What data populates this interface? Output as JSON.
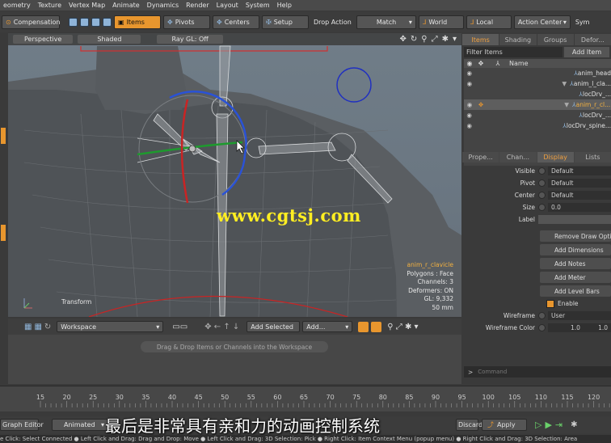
{
  "menu": [
    "eometry",
    "Texture",
    "Vertex Map",
    "Animate",
    "Dynamics",
    "Render",
    "Layout",
    "System",
    "Help"
  ],
  "toolbar": {
    "compensation": "Compensation",
    "items": "Items",
    "pivots": "Pivots",
    "centers": "Centers",
    "setup": "Setup",
    "drop_action_label": "Drop Action",
    "drop_action_value": "Match",
    "world": "World",
    "local": "Local",
    "action_center": "Action Center",
    "sym": "Sym"
  },
  "viewport": {
    "view_mode": "Perspective",
    "shading": "Shaded",
    "render_mode": "Ray GL: Off",
    "transform_label": "Transform",
    "watermark": "www.cgtsj.com",
    "info": {
      "selected": "anim_r_clavicle",
      "polygons": "Polygons : Face",
      "channels": "Channels: 3",
      "deformers": "Deformers: ON",
      "gl": "GL: 9,332",
      "units": "50 mm"
    }
  },
  "workspace": {
    "name": "Workspace",
    "add_selected": "Add Selected",
    "add": "Add...",
    "hint": "Drag & Drop Items or Channels into the Workspace"
  },
  "right_panel": {
    "tabs": [
      "Items",
      "Shading",
      "Groups",
      "Defor..."
    ],
    "filter_placeholder": "Filter Items",
    "add_item": "Add Item",
    "tree_name_header": "Name",
    "tree_rows": [
      {
        "label": "anim_head",
        "selected": false
      },
      {
        "label": "anim_l_cla...",
        "selected": false
      },
      {
        "label": "locDrv_...",
        "selected": false
      },
      {
        "label": "anim_r_cl...",
        "selected": true
      },
      {
        "label": "locDrv_...",
        "selected": false
      },
      {
        "label": "locDrv_spine...",
        "selected": false
      }
    ],
    "prop_tabs": [
      "Prope...",
      "Chan...",
      "Display",
      "Lists"
    ],
    "props": [
      {
        "label": "Visible",
        "value": "Default"
      },
      {
        "label": "Pivot",
        "value": "Default"
      },
      {
        "label": "Center",
        "value": "Default"
      },
      {
        "label": "Size",
        "value": "0.0"
      },
      {
        "label": "Label",
        "value": ""
      }
    ],
    "buttons": [
      "Remove Draw Opti...",
      "Add Dimensions",
      "Add Notes",
      "Add Meter",
      "Add Level Bars"
    ],
    "enable": "Enable",
    "wireframe_label": "Wireframe",
    "wireframe_value": "User",
    "wireframe_color_label": "Wireframe Color",
    "wireframe_color_value": "1.0",
    "wireframe_color_value2": "1.0",
    "command_placeholder": "Command"
  },
  "timeline": {
    "labels": [
      "15",
      "20",
      "25",
      "30",
      "35",
      "40",
      "45",
      "50",
      "55",
      "60",
      "65",
      "70",
      "75",
      "80",
      "85",
      "90",
      "95",
      "100",
      "105",
      "110",
      "115",
      "120"
    ],
    "ticks": [
      15,
      20,
      25,
      30,
      35,
      40,
      45,
      50,
      55,
      60,
      65,
      70,
      75,
      80,
      85,
      90,
      95,
      100,
      105,
      110,
      115,
      120
    ],
    "marker": "100"
  },
  "bottom_bar": {
    "graph_editor": "Graph Editor",
    "animated": "Animated",
    "discard": "Discard",
    "apply": "Apply"
  },
  "subtitle": "最后是非常具有亲和力的动画控制系统",
  "status": "e Click: Select Connected ● Left Click and Drag: Drag and Drop: Move ● Left Click and Drag: 3D Selection: Pick ● Right Click: Item Context Menu (popup menu) ● Right Click and Drag: 3D Selection: Area"
}
